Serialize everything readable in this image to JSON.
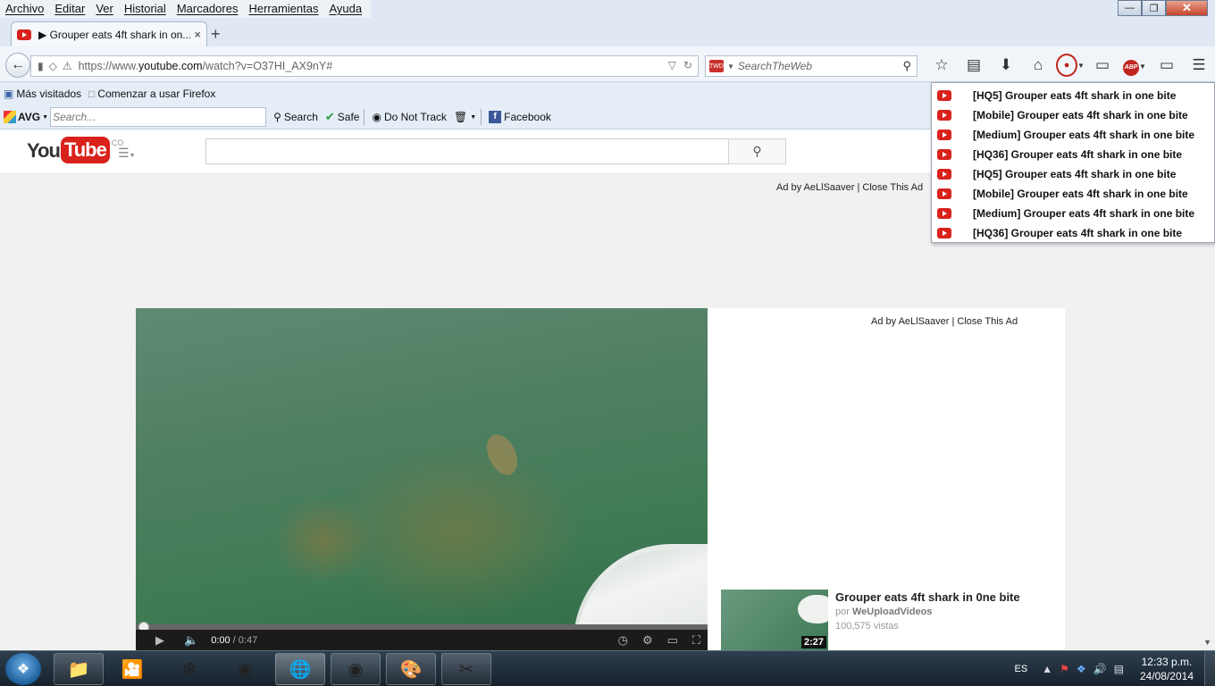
{
  "menubar": {
    "items": [
      "Archivo",
      "Editar",
      "Ver",
      "Historial",
      "Marcadores",
      "Herramientas",
      "Ayuda"
    ],
    "window_controls": [
      "minimize-icon",
      "restore-icon",
      "close-icon"
    ]
  },
  "tab": {
    "title": "▶ Grouper eats 4ft shark in on...",
    "close": "×",
    "new_tab": "+"
  },
  "navbar": {
    "url_prefix": "https://www.",
    "url_domain": "youtube.com",
    "url_path": "/watch?v=O37HI_AX9nY#",
    "search_placeholder": "SearchTheWeb",
    "search_engine_label": "TWD"
  },
  "bookmarks": {
    "items": [
      "Más visitados",
      "Comenzar a usar Firefox"
    ]
  },
  "avg": {
    "logo": "AVG",
    "search_placeholder": "Search...",
    "search_label": "Search",
    "safe_label": "Safe",
    "dnt_label": "Do Not Track",
    "facebook_label": "Facebook"
  },
  "youtube": {
    "logo_you": "You",
    "logo_tube": "Tube",
    "logo_country": "CO",
    "search_value": "",
    "ad_line_top": "Ad by AeLlSaaver | Close This Ad",
    "ad_line_side": "Ad by AeLlSaaver | Close This Ad"
  },
  "player": {
    "current_time": "0:00",
    "duration": "/ 0:47",
    "progress_fraction": 0.0
  },
  "related": {
    "title": "Grouper eats 4ft shark in 0ne bite",
    "by_prefix": "por",
    "channel": "WeUploadVideos",
    "views": "100,575 vistas",
    "duration": "2:27"
  },
  "dropdown": {
    "items": [
      "[HQ5] Grouper eats 4ft shark in one bite",
      "[Mobile] Grouper eats 4ft shark in one bite",
      "[Medium] Grouper eats 4ft shark in one bite",
      "[HQ36] Grouper eats 4ft shark in one bite",
      "[HQ5] Grouper eats 4ft shark in one bite",
      "[Mobile] Grouper eats 4ft shark in one bite",
      "[Medium] Grouper eats 4ft shark in one bite",
      "[HQ36] Grouper eats 4ft shark in one bite"
    ]
  },
  "taskbar": {
    "lang": "ES",
    "time": "12:33 p.m.",
    "date": "24/08/2014",
    "apps": [
      "file-explorer-icon",
      "media-player-icon",
      "inkscape-icon",
      "chrome-icon",
      "firefox-icon",
      "chrome-canary-icon",
      "paint-icon",
      "snipping-tool-icon"
    ]
  },
  "colors": {
    "youtube_red": "#d8221b",
    "highlight_ring": "#c0261f",
    "taskbar": "#1f2d3a"
  }
}
